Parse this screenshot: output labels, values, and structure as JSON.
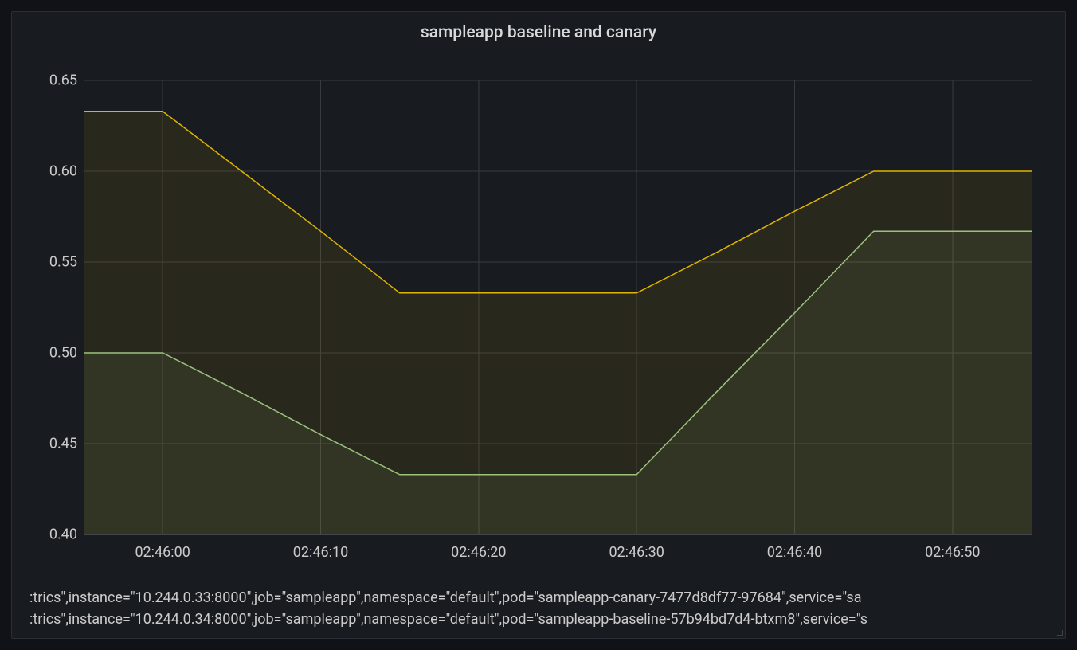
{
  "title": "sampleapp baseline and canary",
  "chart_data": {
    "type": "area",
    "title": "sampleapp baseline and canary",
    "xlabel": "",
    "ylabel": "",
    "ylim": [
      0.4,
      0.65
    ],
    "y_ticks": [
      0.4,
      0.45,
      0.5,
      0.55,
      0.6,
      0.65
    ],
    "y_tick_labels": [
      "0.40",
      "0.45",
      "0.50",
      "0.55",
      "0.60",
      "0.65"
    ],
    "x_ticks": [
      "02:46:00",
      "02:46:10",
      "02:46:20",
      "02:46:30",
      "02:46:40",
      "02:46:50"
    ],
    "x_range_seconds": [
      -5,
      55
    ],
    "categories_seconds": [
      -5,
      0,
      5,
      10,
      15,
      20,
      25,
      30,
      35,
      40,
      45,
      50,
      55
    ],
    "series": [
      {
        "name": "canary",
        "legend": ":trics\",instance=\"10.244.0.33:8000\",job=\"sampleapp\",namespace=\"default\",pod=\"sampleapp-canary-7477d8df77-97684\",service=\"sa",
        "color": "#e0b400",
        "fill": "rgba(224,180,0,0.09)",
        "values": [
          0.633,
          0.633,
          0.6,
          0.567,
          0.533,
          0.533,
          0.533,
          0.533,
          0.555,
          0.578,
          0.6,
          0.6,
          0.6
        ]
      },
      {
        "name": "baseline",
        "legend": ":trics\",instance=\"10.244.0.34:8000\",job=\"sampleapp\",namespace=\"default\",pod=\"sampleapp-baseline-57b94bd7d4-btxm8\",service=\"s",
        "color": "#9ac27c",
        "fill": "rgba(154,194,124,0.09)",
        "values": [
          0.5,
          0.5,
          0.478,
          0.455,
          0.433,
          0.433,
          0.433,
          0.433,
          0.478,
          0.522,
          0.567,
          0.567,
          0.567
        ]
      }
    ]
  }
}
